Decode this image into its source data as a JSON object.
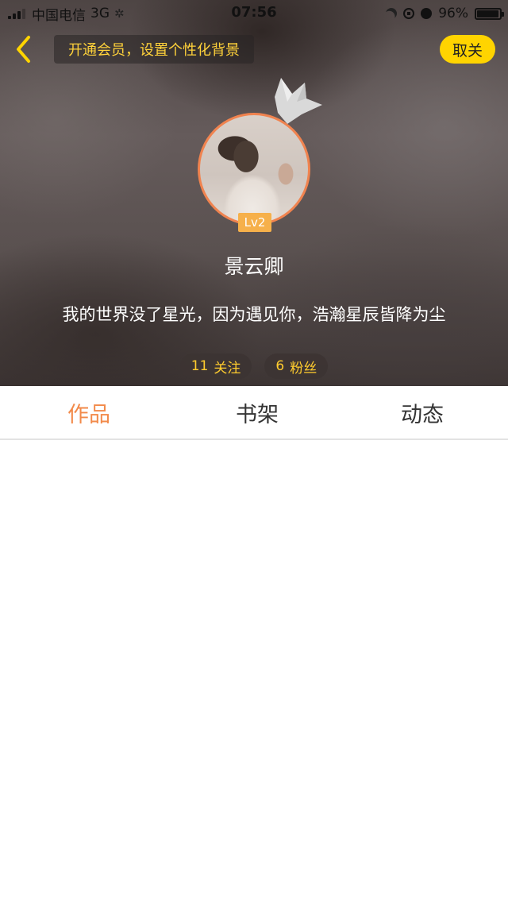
{
  "status_bar": {
    "carrier": "中国电信",
    "network": "3G",
    "time": "07:56",
    "battery_percent": "96%",
    "battery_level": 0.96
  },
  "header": {
    "promo_text": "开通会员，设置个性化背景",
    "cancel_label": "取关"
  },
  "profile": {
    "level": "Lv2",
    "nickname": "景云卿",
    "bio": "我的世界没了星光，因为遇见你，浩瀚星辰皆降为尘",
    "following_count": "11",
    "following_label": "关注",
    "followers_count": "6",
    "followers_label": "粉丝"
  },
  "tabs": [
    {
      "label": "作品",
      "active": true
    },
    {
      "label": "书架",
      "active": false
    },
    {
      "label": "动态",
      "active": false
    }
  ],
  "colors": {
    "accent_orange": "#f28a4a",
    "accent_yellow": "#ffd400",
    "stat_text": "#ffcc2e"
  }
}
